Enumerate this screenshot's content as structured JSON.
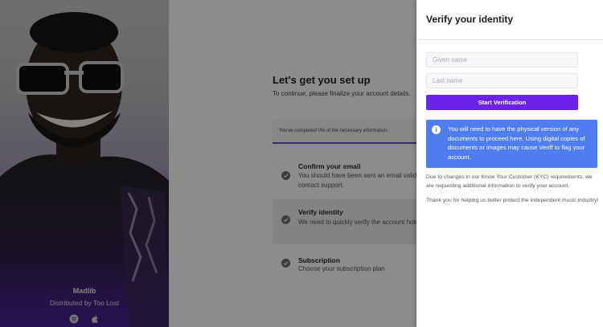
{
  "artist": {
    "name": "Madlib",
    "distribution": "Distributed by Too Lost",
    "icons": [
      "spotify-icon",
      "apple-icon"
    ]
  },
  "setup": {
    "title": "Let's get you set up",
    "subtitle": "To continue, please finalize your account details.",
    "progress_text": "You've completed 0% of the necessary information.",
    "progress_percent": 0,
    "steps": [
      {
        "title": "Confirm your email",
        "description": "You should have been sent an email validati... didn't receive this, please contact support."
      },
      {
        "title": "Verify identity",
        "description": "We need to quickly verify the account holde... information."
      },
      {
        "title": "Subscription",
        "description": "Choose your subscription plan"
      }
    ]
  },
  "drawer": {
    "title": "Verify your identity",
    "given_name_placeholder": "Given name",
    "last_name_placeholder": "Last name",
    "button_label": "Start Verification",
    "info_icon": "i",
    "info_text": "You will need to have the physical version of any documents to proceed here. Using digital copies of documents or images may cause Veriff to flag your account.",
    "note_kyc": "Due to changes in our Know Your Customer (KYC) requirements, we are requesting additional information to verify your account.",
    "note_thanks": "Thank you for helping us better protect the independent music industry!"
  },
  "colors": {
    "accent": "#6b21e8",
    "info": "#4d7df0",
    "progress": "#6a4bd6"
  }
}
